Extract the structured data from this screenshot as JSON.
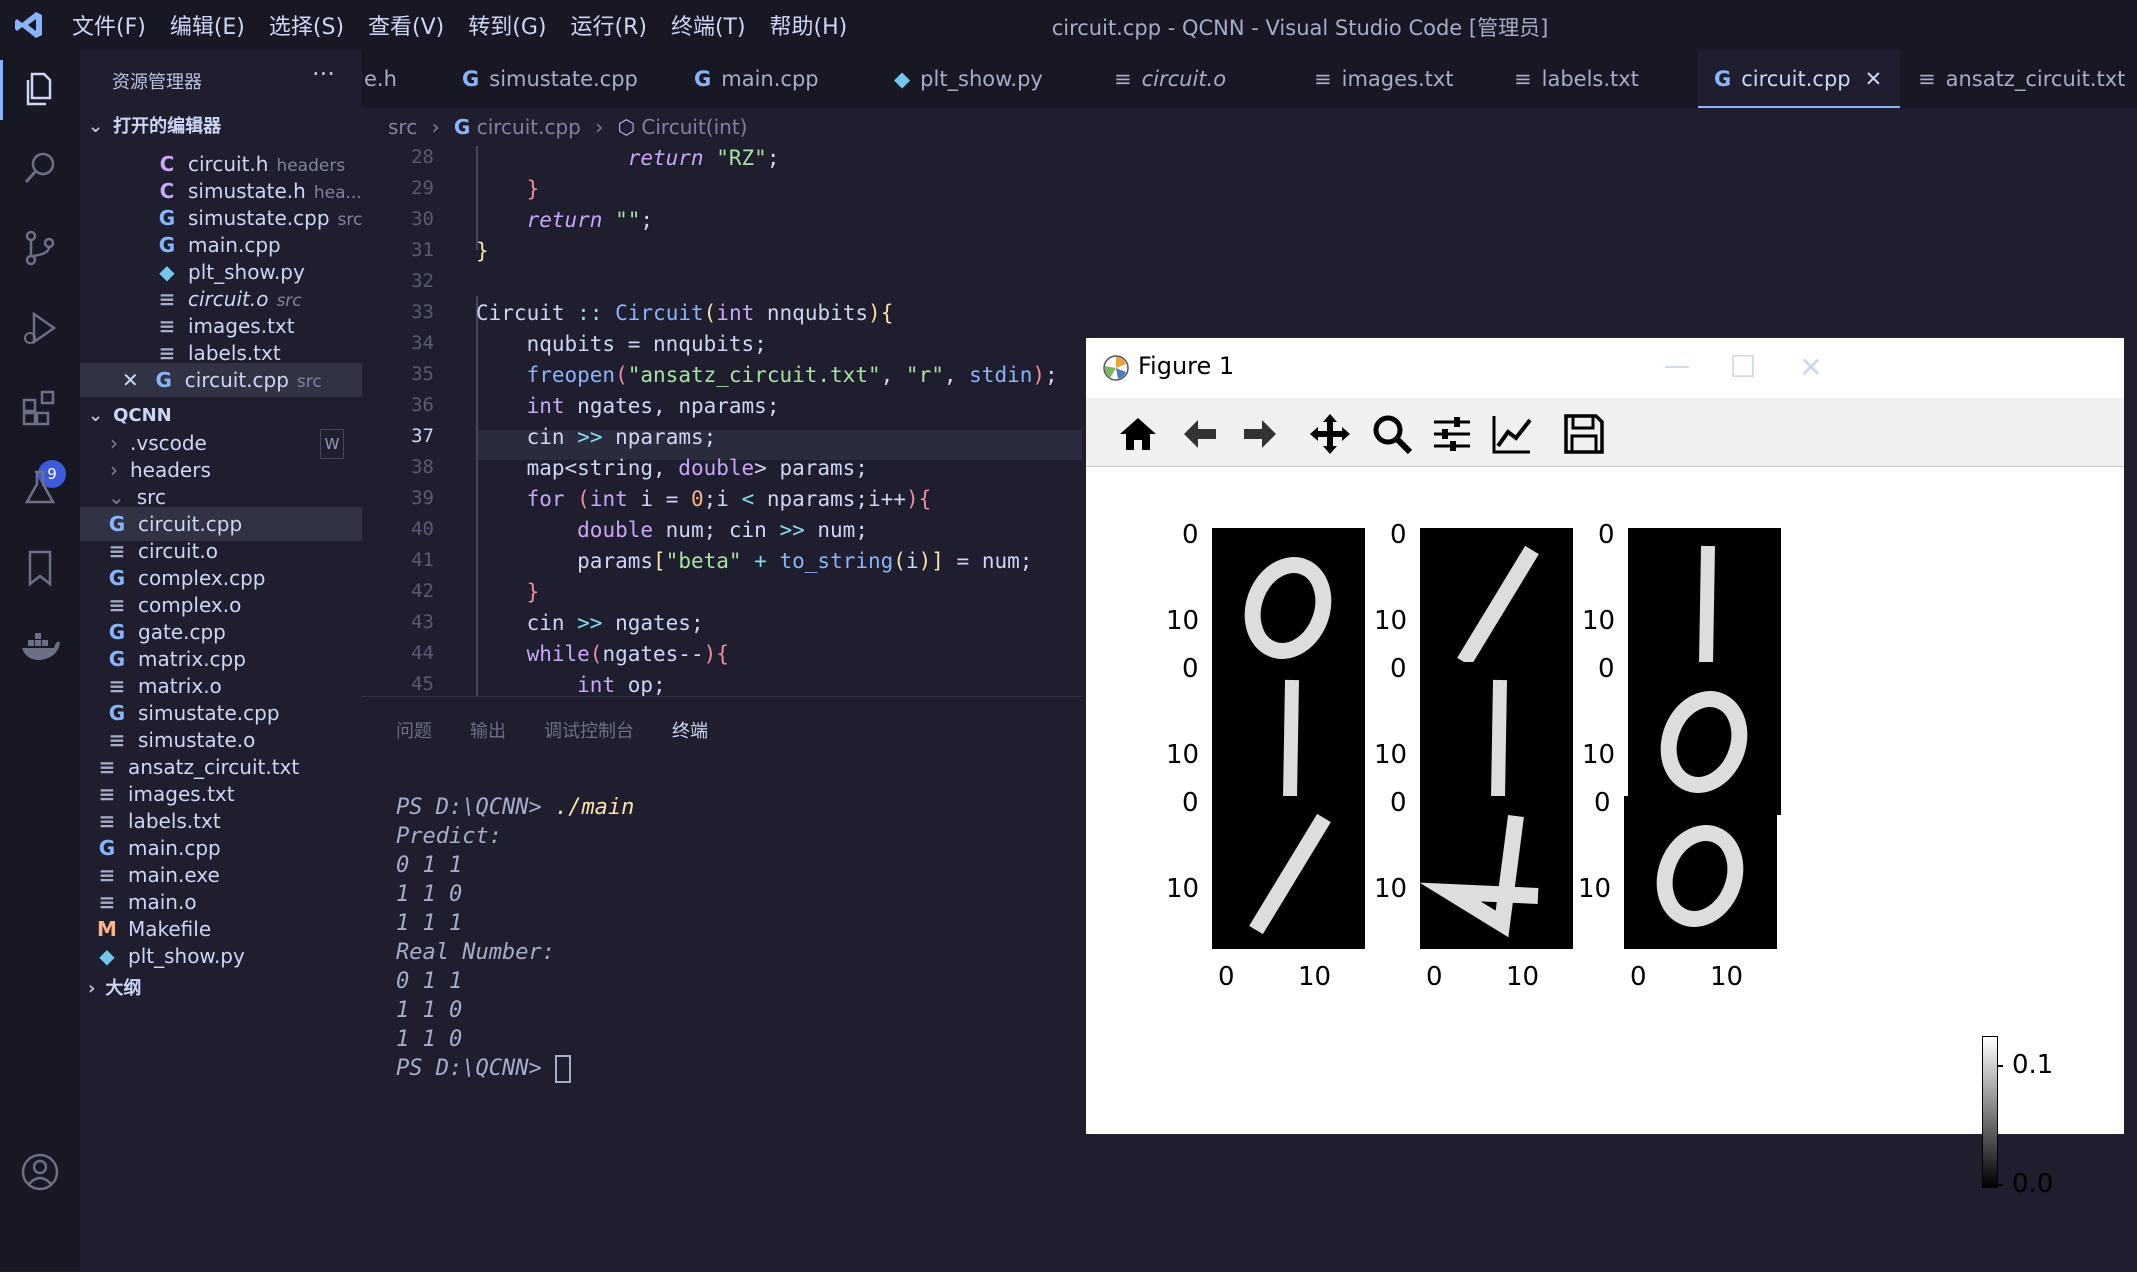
{
  "app": {
    "window_title": "circuit.cpp - QCNN - Visual Studio Code [管理员]",
    "menu": [
      "文件(F)",
      "编辑(E)",
      "选择(S)",
      "查看(V)",
      "转到(G)",
      "运行(R)",
      "终端(T)",
      "帮助(H)"
    ]
  },
  "activity": {
    "extensions_badge": "9"
  },
  "sidebar": {
    "title": "资源管理器",
    "more": "···",
    "open_editors_header": "打开的编辑器",
    "open_editors": [
      {
        "name": "circuit.h",
        "sub": "headers",
        "icon": "c"
      },
      {
        "name": "simustate.h",
        "sub": "hea...",
        "icon": "c"
      },
      {
        "name": "simustate.cpp",
        "sub": "src",
        "icon": "cpp"
      },
      {
        "name": "main.cpp",
        "sub": "",
        "icon": "cpp"
      },
      {
        "name": "plt_show.py",
        "sub": "",
        "icon": "py"
      },
      {
        "name": "circuit.o",
        "sub": "src",
        "icon": "txt"
      },
      {
        "name": "images.txt",
        "sub": "",
        "icon": "txt"
      },
      {
        "name": "labels.txt",
        "sub": "",
        "icon": "txt"
      },
      {
        "name": "circuit.cpp",
        "sub": "src",
        "icon": "cpp"
      }
    ],
    "project_header": "QCNN",
    "folders": {
      ".vscode": ".vscode",
      "headers": "headers",
      "src": "src"
    },
    "w_badge": "W",
    "src_files": [
      "circuit.cpp",
      "circuit.o",
      "complex.cpp",
      "complex.o",
      "gate.cpp",
      "matrix.cpp",
      "matrix.o",
      "simustate.cpp",
      "simustate.o"
    ],
    "root_files": [
      "ansatz_circuit.txt",
      "images.txt",
      "labels.txt",
      "main.cpp",
      "main.exe",
      "main.o",
      "Makefile",
      "plt_show.py"
    ],
    "outline_header": "大纲"
  },
  "tabs": [
    "e.h",
    "simustate.cpp",
    "main.cpp",
    "plt_show.py",
    "circuit.o",
    "images.txt",
    "labels.txt",
    "circuit.cpp",
    "ansatz_circuit.txt"
  ],
  "breadcrumb": {
    "folder": "src",
    "file": "circuit.cpp",
    "symbol": "Circuit(int)"
  },
  "editor": {
    "line_numbers": [
      "28",
      "29",
      "30",
      "31",
      "32",
      "33",
      "34",
      "35",
      "36",
      "37",
      "38",
      "39",
      "40",
      "41",
      "42",
      "43",
      "44",
      "45"
    ]
  },
  "panel": {
    "tabs": [
      "问题",
      "输出",
      "调试控制台",
      "终端"
    ],
    "terminal": {
      "prompt": "PS D:\\QCNN>",
      "command": " ./main",
      "lines": [
        "Predict:",
        "0 1 1",
        "1 1 0",
        "1 1 1",
        "Real Number:",
        "0 1 1",
        "1 1 0",
        "1 1 0"
      ],
      "final_prompt": "PS D:\\QCNN> "
    }
  },
  "figure": {
    "title": "Figure 1",
    "controls": {
      "minimize": "—",
      "maximize": "☐",
      "close": "✕"
    },
    "toolbar_icons": [
      "home-icon",
      "back-icon",
      "forward-icon",
      "pan-icon",
      "zoom-icon",
      "configure-subplots-icon",
      "edit-axes-icon",
      "save-icon"
    ],
    "axis_ticks": {
      "y": [
        "0",
        "10"
      ],
      "x": [
        "0",
        "10"
      ]
    },
    "digits": [
      "0",
      "1",
      "1",
      "1",
      "1",
      "0",
      "1",
      "1",
      "0"
    ],
    "colorbar_ticks": [
      "0.1",
      "0.0"
    ]
  },
  "colors": {
    "accent": "#89b4fa",
    "bg": "#1e1e2e",
    "badge": "#3b5bdb"
  }
}
